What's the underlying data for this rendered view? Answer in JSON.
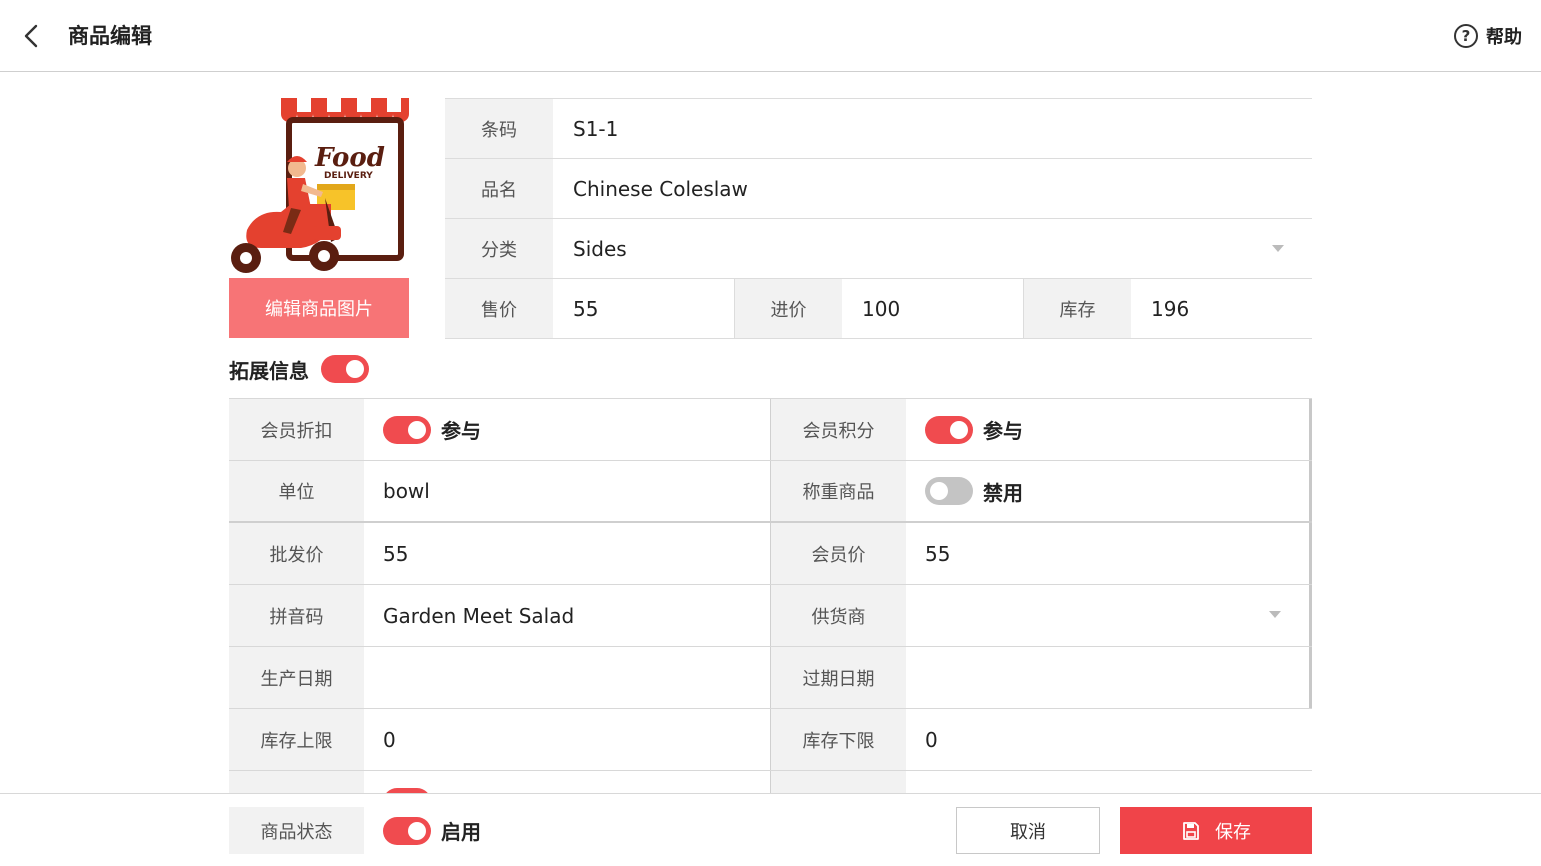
{
  "header": {
    "title": "商品编辑",
    "help_label": "帮助",
    "help_glyph": "?"
  },
  "image": {
    "logo_text": "Food",
    "logo_subtext": "DELIVERY",
    "edit_button": "编辑商品图片"
  },
  "basic": {
    "barcode_label": "条码",
    "barcode": "S1-1",
    "name_label": "品名",
    "name": "Chinese Coleslaw",
    "category_label": "分类",
    "category": "Sides",
    "sale_price_label": "售价",
    "sale_price": "55",
    "cost_price_label": "进价",
    "cost_price": "100",
    "stock_label": "库存",
    "stock": "196"
  },
  "extended": {
    "title": "拓展信息",
    "enabled": true,
    "rows": [
      {
        "left": {
          "label": "会员折扣",
          "value": "参与",
          "toggle": true
        },
        "right": {
          "label": "会员积分",
          "value": "参与",
          "toggle": true
        }
      },
      {
        "left": {
          "label": "单位",
          "value": "bowl"
        },
        "right": {
          "label": "称重商品",
          "value": "禁用",
          "toggle": false
        }
      },
      {
        "left": {
          "label": "批发价",
          "value": "55"
        },
        "right": {
          "label": "会员价",
          "value": "55"
        }
      },
      {
        "left": {
          "label": "拼音码",
          "value": "Garden Meet Salad"
        },
        "right": {
          "label": "供货商",
          "value": ""
        }
      },
      {
        "left": {
          "label": "生产日期",
          "value": ""
        },
        "right": {
          "label": "过期日期",
          "value": ""
        }
      },
      {
        "left": {
          "label": "库存上限",
          "value": "0"
        },
        "right": {
          "label": "库存下限",
          "value": "0"
        }
      }
    ]
  },
  "footer": {
    "status_label": "商品状态",
    "status_value": "启用",
    "status_enabled": true,
    "cancel_label": "取消",
    "save_label": "保存"
  },
  "colors": {
    "accent": "#f04449",
    "image_button": "#f77476",
    "toggle_off": "#c4c4c4",
    "label_bg": "#f2f2f2"
  }
}
